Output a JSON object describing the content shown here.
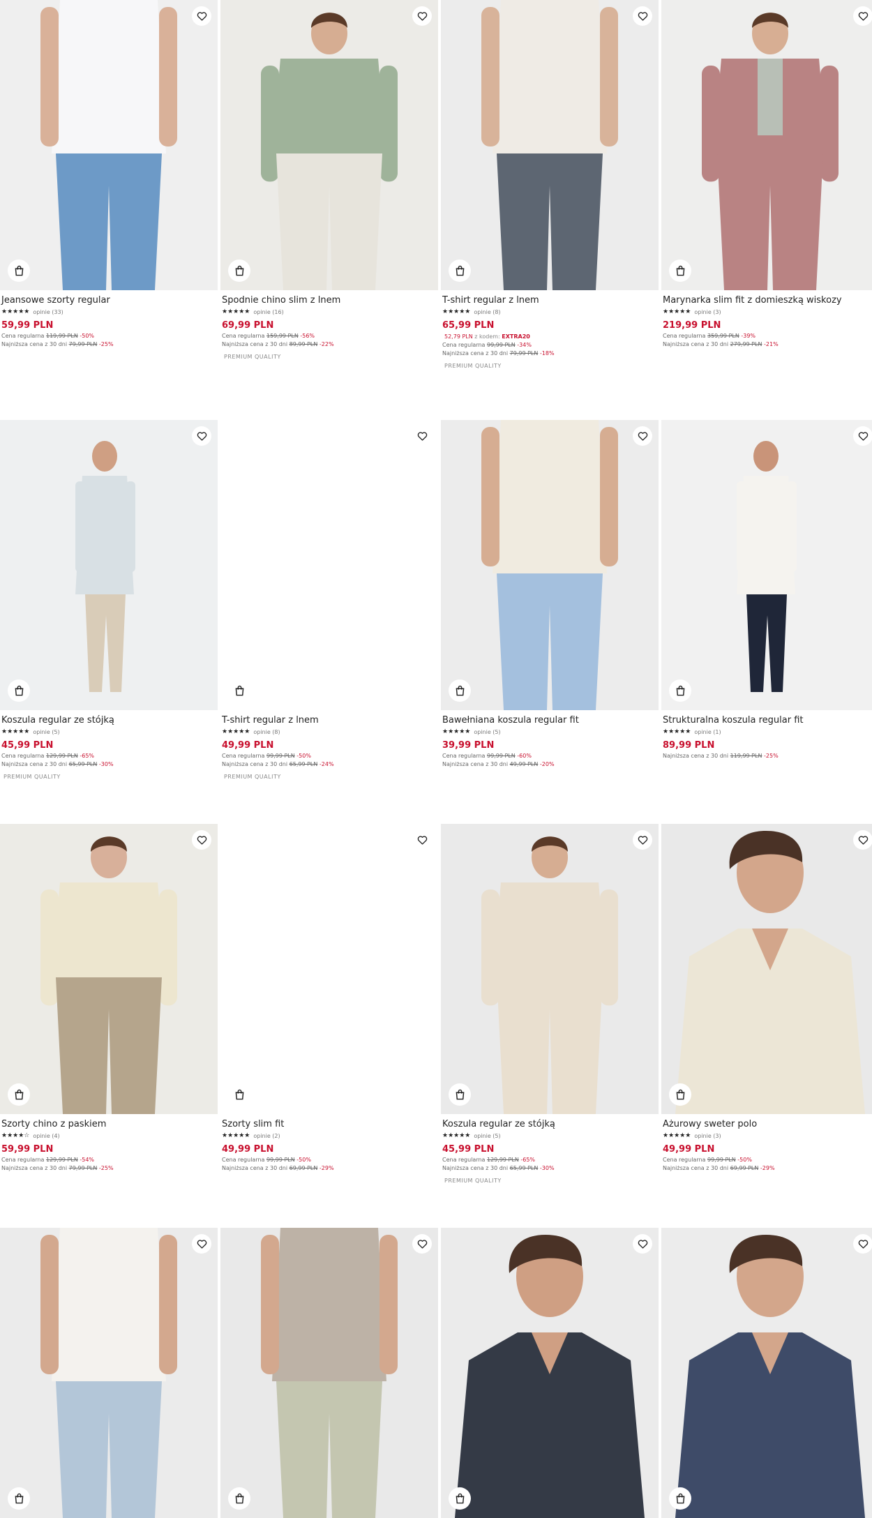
{
  "products": [
    {
      "title": "Jeansowe szorty regular",
      "stars": "★★★★★",
      "reviews": "opinie (33)",
      "price": "59,99 PLN",
      "regular_label": "Cena regularna",
      "regular_price": "119,99 PLN",
      "regular_discount": "-50%",
      "lowest_label": "Najniższa cena z 30 dni",
      "lowest_price": "79,99 PLN",
      "lowest_discount": "-25%",
      "image": "model-white-top-denim-shorts"
    },
    {
      "title": "Spodnie chino slim z lnem",
      "stars": "★★★★★",
      "reviews": "opinie (16)",
      "price": "69,99 PLN",
      "regular_label": "Cena regularna",
      "regular_price": "159,99 PLN",
      "regular_discount": "-56%",
      "lowest_label": "Najniższa cena z 30 dni",
      "lowest_price": "89,99 PLN",
      "lowest_discount": "-22%",
      "badge": "PREMIUM QUALITY",
      "image": "model-green-shirt-white-chinos"
    },
    {
      "title": "T-shirt regular z lnem",
      "stars": "★★★★★",
      "reviews": "opinie (8)",
      "price": "65,99 PLN",
      "code_price": "52,79 PLN",
      "code_text": "z kodem:",
      "code": "EXTRA20",
      "regular_label": "Cena regularna",
      "regular_price": "99,99 PLN",
      "regular_discount": "-34%",
      "lowest_label": "Najniższa cena z 30 dni",
      "lowest_price": "79,99 PLN",
      "lowest_discount": "-18%",
      "badge": "PREMIUM QUALITY",
      "image": "model-cream-tshirt-grey-trousers"
    },
    {
      "title": "Marynarka slim fit z domieszką wiskozy",
      "stars": "★★★★★",
      "reviews": "opinie (3)",
      "price": "219,99 PLN",
      "regular_label": "Cena regularna",
      "regular_price": "359,99 PLN",
      "regular_discount": "-39%",
      "lowest_label": "Najniższa cena z 30 dni",
      "lowest_price": "279,99 PLN",
      "lowest_discount": "-21%",
      "image": "model-pink-suit"
    },
    {
      "title": "Koszula regular ze stójką",
      "stars": "★★★★★",
      "reviews": "opinie (5)",
      "price": "45,99 PLN",
      "regular_label": "Cena regularna",
      "regular_price": "129,99 PLN",
      "regular_discount": "-65%",
      "lowest_label": "Najniższa cena z 30 dni",
      "lowest_price": "65,99 PLN",
      "lowest_discount": "-30%",
      "badge": "PREMIUM QUALITY",
      "image": "model-light-blue-shirt-beige-shorts"
    },
    {
      "title": "T-shirt regular z lnem",
      "stars": "★★★★★",
      "reviews": "opinie (8)",
      "price": "49,99 PLN",
      "regular_label": "Cena regularna",
      "regular_price": "99,99 PLN",
      "regular_discount": "-50%",
      "lowest_label": "Najniższa cena z 30 dni",
      "lowest_price": "65,99 PLN",
      "lowest_discount": "-24%",
      "badge": "PREMIUM QUALITY",
      "image": "blank"
    },
    {
      "title": "Bawełniana koszula regular fit",
      "stars": "★★★★★",
      "reviews": "opinie (5)",
      "price": "39,99 PLN",
      "regular_label": "Cena regularna",
      "regular_price": "99,99 PLN",
      "regular_discount": "-60%",
      "lowest_label": "Najniższa cena z 30 dni",
      "lowest_price": "49,99 PLN",
      "lowest_discount": "-20%",
      "image": "model-cream-shortsleeve-shirt-jeans"
    },
    {
      "title": "Strukturalna koszula regular fit",
      "stars": "★★★★★",
      "reviews": "opinie (1)",
      "price": "89,99 PLN",
      "lowest_label": "Najniższa cena z 30 dni",
      "lowest_price": "119,99 PLN",
      "lowest_discount": "-25%",
      "image": "model-white-shirt-navy-trousers"
    },
    {
      "title": "Szorty chino z paskiem",
      "stars": "★★★★☆",
      "reviews": "opinie (4)",
      "price": "59,99 PLN",
      "regular_label": "Cena regularna",
      "regular_price": "129,99 PLN",
      "regular_discount": "-54%",
      "lowest_label": "Najniższa cena z 30 dni",
      "lowest_price": "79,99 PLN",
      "lowest_discount": "-25%",
      "image": "model-cream-tee-khaki-shorts"
    },
    {
      "title": "Szorty slim fit",
      "stars": "★★★★★",
      "reviews": "opinie (2)",
      "price": "49,99 PLN",
      "regular_label": "Cena regularna",
      "regular_price": "99,99 PLN",
      "regular_discount": "-50%",
      "lowest_label": "Najniższa cena z 30 dni",
      "lowest_price": "69,99 PLN",
      "lowest_discount": "-29%",
      "image": "blank"
    },
    {
      "title": "Koszula regular ze stójką",
      "stars": "★★★★★",
      "reviews": "opinie (5)",
      "price": "45,99 PLN",
      "regular_label": "Cena regularna",
      "regular_price": "129,99 PLN",
      "regular_discount": "-65%",
      "lowest_label": "Najniższa cena z 30 dni",
      "lowest_price": "65,99 PLN",
      "lowest_discount": "-30%",
      "badge": "PREMIUM QUALITY",
      "image": "model-beige-popover-shirt"
    },
    {
      "title": "Ażurowy sweter polo",
      "stars": "★★★★★",
      "reviews": "opinie (3)",
      "price": "49,99 PLN",
      "regular_label": "Cena regularna",
      "regular_price": "99,99 PLN",
      "regular_discount": "-50%",
      "lowest_label": "Najniższa cena z 30 dni",
      "lowest_price": "69,99 PLN",
      "lowest_discount": "-29%",
      "image": "model-cream-knit-polo"
    },
    {
      "image": "model-white-resort-shirt"
    },
    {
      "image": "model-beige-resort-shirt"
    },
    {
      "image": "model-navy-resort-shirt"
    },
    {
      "image": "model-navy-textured-shirt"
    }
  ],
  "icons": {
    "favorite": "heart-icon",
    "cart": "shopping-bag-icon"
  },
  "colors": {
    "sale": "#c8102e",
    "text": "#222222",
    "muted": "#666666"
  }
}
